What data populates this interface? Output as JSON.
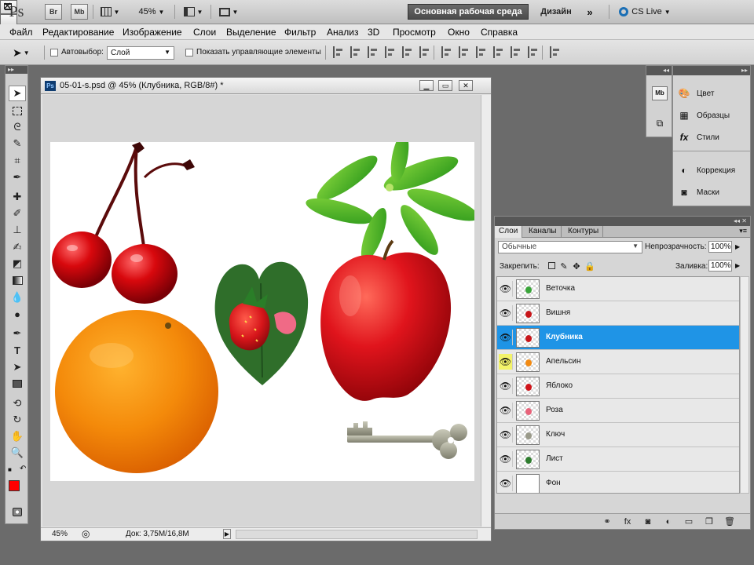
{
  "appbar": {
    "logo": "Ps",
    "bridge_label": "Br",
    "minibridge_label": "Mb",
    "zoom": "45%",
    "workspace_button": "Основная рабочая среда",
    "design_label": "Дизайн",
    "more_label": "»",
    "cslive_label": "CS Live"
  },
  "menu": [
    "Файл",
    "Редактирование",
    "Изображение",
    "Слои",
    "Выделение",
    "Фильтр",
    "Анализ",
    "3D",
    "Просмотр",
    "Окно",
    "Справка"
  ],
  "options": {
    "tool_icon": "move-tool-icon",
    "autoselect_label": "Автовыбор:",
    "autoselect_value": "Слой",
    "show_controls_label": "Показать управляющие элементы"
  },
  "document": {
    "title": "05-01-s.psd @ 45% (Клубника, RGB/8#) *",
    "badge": "Ps",
    "status_zoom": "45%",
    "status_doc": "Док: 3,75M/16,8M",
    "objects": [
      "cherries",
      "orange",
      "strawberry-on-leaf",
      "apple",
      "leaves",
      "key"
    ]
  },
  "side_panels": {
    "icons": [
      "Mb",
      "history-icon"
    ],
    "items": [
      {
        "name": "color",
        "label": "Цвет",
        "icon": "palette-icon"
      },
      {
        "name": "swatches",
        "label": "Образцы",
        "icon": "grid-icon"
      },
      {
        "name": "styles",
        "label": "Стили",
        "icon": "fx-icon"
      },
      {
        "name": "adjustments",
        "label": "Коррекция",
        "icon": "circle-half-icon"
      },
      {
        "name": "masks",
        "label": "Маски",
        "icon": "mask-icon"
      }
    ]
  },
  "layers_panel": {
    "tabs": [
      "Слои",
      "Каналы",
      "Контуры"
    ],
    "active_tab": "Слои",
    "blend_mode": "Обычные",
    "opacity_label": "Непрозрачность:",
    "opacity": "100%",
    "lock_label": "Закрепить:",
    "fill_label": "Заливка:",
    "fill": "100%",
    "layers": [
      {
        "name": "Веточка",
        "thumb_color": "#3aa53a",
        "selected": false,
        "eye_highlight": false,
        "is_background": false
      },
      {
        "name": "Вишня",
        "thumb_color": "#c8161a",
        "selected": false,
        "eye_highlight": false,
        "is_background": false
      },
      {
        "name": "Клубника",
        "thumb_color": "#c8161a",
        "selected": true,
        "eye_highlight": false,
        "is_background": false
      },
      {
        "name": "Апельсин",
        "thumb_color": "#f28a12",
        "selected": false,
        "eye_highlight": true,
        "is_background": false
      },
      {
        "name": "Яблоко",
        "thumb_color": "#d0141a",
        "selected": false,
        "eye_highlight": false,
        "is_background": false
      },
      {
        "name": "Роза",
        "thumb_color": "#e8637a",
        "selected": false,
        "eye_highlight": false,
        "is_background": false
      },
      {
        "name": "Ключ",
        "thumb_color": "#9a9a8a",
        "selected": false,
        "eye_highlight": false,
        "is_background": false
      },
      {
        "name": "Лист",
        "thumb_color": "#2f7d2f",
        "selected": false,
        "eye_highlight": false,
        "is_background": false
      },
      {
        "name": "Фон",
        "thumb_color": "#ffffff",
        "selected": false,
        "eye_highlight": false,
        "is_background": true
      }
    ]
  },
  "colors": {
    "foreground": "#ff0000",
    "background": "#ffffff",
    "selection": "#1f94e6"
  }
}
